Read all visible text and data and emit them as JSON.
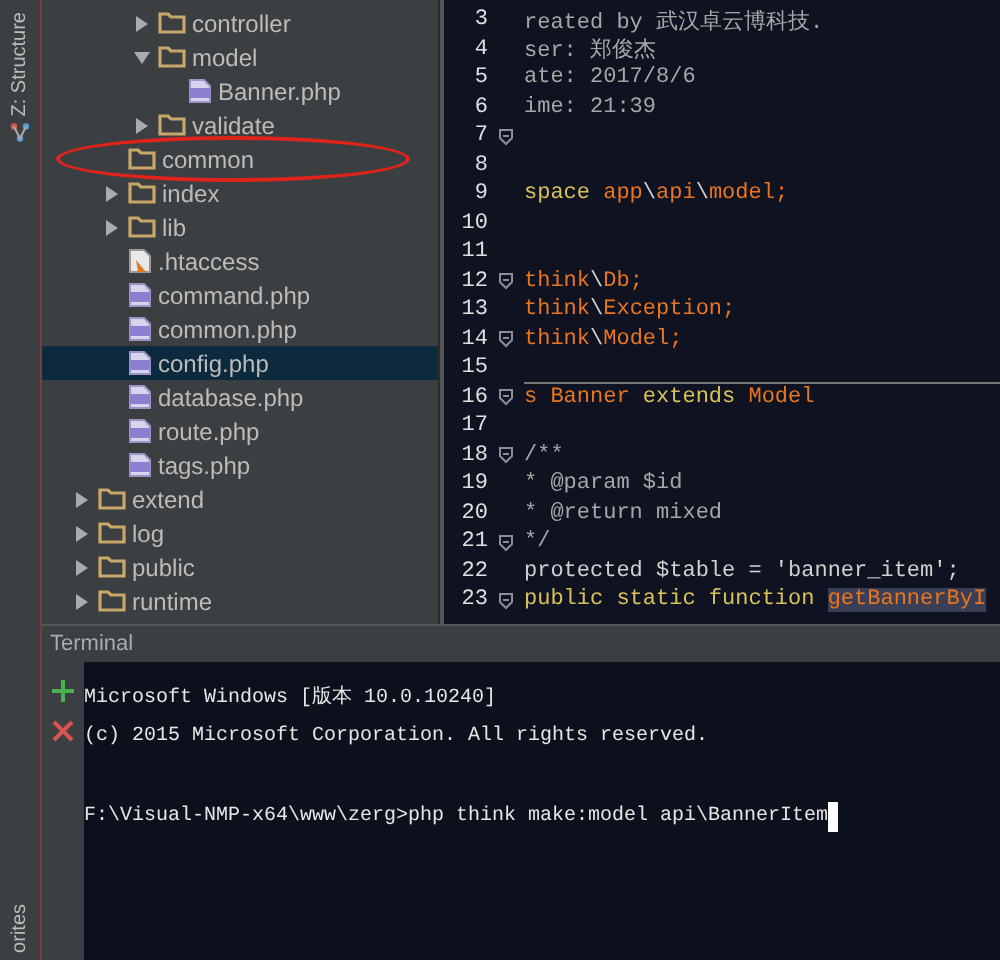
{
  "side_strip": {
    "top_tab": "Z: Structure",
    "bottom_tab": "orites"
  },
  "tree": [
    {
      "children": [
        {
          "children": [
            {
              "name": "controller",
              "kind": "folder",
              "expanded": false,
              "selected": false
            },
            {
              "name": "model",
              "kind": "folder",
              "expanded": true,
              "selected": false,
              "children": [
                {
                  "name": "Banner.php",
                  "kind": "php",
                  "selected": false
                }
              ]
            },
            {
              "name": "validate",
              "kind": "folder",
              "expanded": false,
              "selected": false
            }
          ]
        },
        {
          "name": "common",
          "kind": "folder",
          "selected": false,
          "circled": true
        },
        {
          "name": "index",
          "kind": "folder",
          "expanded": false,
          "selected": false
        },
        {
          "name": "lib",
          "kind": "folder",
          "expanded": false,
          "selected": false
        },
        {
          "name": ".htaccess",
          "kind": "htaccess",
          "selected": false
        },
        {
          "name": "command.php",
          "kind": "php",
          "selected": false
        },
        {
          "name": "common.php",
          "kind": "php",
          "selected": false
        },
        {
          "name": "config.php",
          "kind": "php",
          "selected": true
        },
        {
          "name": "database.php",
          "kind": "php",
          "selected": false
        },
        {
          "name": "route.php",
          "kind": "php",
          "selected": false
        },
        {
          "name": "tags.php",
          "kind": "php",
          "selected": false
        }
      ]
    },
    {
      "name": "extend",
      "kind": "folder",
      "expanded": false,
      "selected": false
    },
    {
      "name": "log",
      "kind": "folder",
      "expanded": false,
      "selected": false
    },
    {
      "name": "public",
      "kind": "folder",
      "expanded": false,
      "selected": false
    },
    {
      "name": "runtime",
      "kind": "folder",
      "expanded": false,
      "selected": false
    }
  ],
  "editor": {
    "lines": [
      {
        "number": "3",
        "segments": [
          {
            "text": "reated by 武汉卓云博科技.",
            "kind": "comment"
          }
        ]
      },
      {
        "number": "4",
        "segments": [
          {
            "text": "ser: 郑俊杰",
            "kind": "comment"
          }
        ]
      },
      {
        "number": "5",
        "segments": [
          {
            "text": "ate: 2017/8/6",
            "kind": "comment"
          }
        ]
      },
      {
        "number": "6",
        "segments": [
          {
            "text": "ime: 21:39",
            "kind": "comment"
          }
        ]
      },
      {
        "number": "7",
        "fold": true
      },
      {
        "number": "8"
      },
      {
        "number": "9",
        "segments": [
          {
            "text": "space ",
            "kind": "keyword"
          },
          {
            "text": "app",
            "kind": "name"
          },
          {
            "text": "\\",
            "kind": "plain"
          },
          {
            "text": "api",
            "kind": "name"
          },
          {
            "text": "\\",
            "kind": "plain"
          },
          {
            "text": "model;",
            "kind": "name"
          }
        ]
      },
      {
        "number": "10"
      },
      {
        "number": "11"
      },
      {
        "number": "12",
        "fold": true,
        "segments": [
          {
            "text": "think",
            "kind": "name"
          },
          {
            "text": "\\",
            "kind": "plain"
          },
          {
            "text": "Db;",
            "kind": "name"
          }
        ]
      },
      {
        "number": "13",
        "segments": [
          {
            "text": "think",
            "kind": "name"
          },
          {
            "text": "\\",
            "kind": "plain"
          },
          {
            "text": "Exception;",
            "kind": "name"
          }
        ]
      },
      {
        "number": "14",
        "fold": true,
        "segments": [
          {
            "text": "think",
            "kind": "name"
          },
          {
            "text": "\\",
            "kind": "plain"
          },
          {
            "text": "Model;",
            "kind": "name"
          }
        ]
      },
      {
        "number": "15",
        "separator": true
      },
      {
        "number": "16",
        "fold": true,
        "segments": [
          {
            "text": "s ",
            "kind": "name"
          },
          {
            "text": "Banner ",
            "kind": "name"
          },
          {
            "text": "extends ",
            "kind": "keyword"
          },
          {
            "text": "Model",
            "kind": "name"
          }
        ]
      },
      {
        "number": "17"
      },
      {
        "number": "18",
        "fold": true,
        "segments": [
          {
            "text": "/**",
            "kind": "comment"
          }
        ]
      },
      {
        "number": "19",
        "segments": [
          {
            "text": "  * @param $id",
            "kind": "comment"
          }
        ]
      },
      {
        "number": "20",
        "segments": [
          {
            "text": "  * @return mixed",
            "kind": "comment"
          }
        ]
      },
      {
        "number": "21",
        "fold": true,
        "segments": [
          {
            "text": "  */",
            "kind": "comment"
          }
        ]
      },
      {
        "number": "22",
        "segments": [
          {
            "text": "   protected $table = 'banner_item';",
            "kind": "plain"
          }
        ]
      },
      {
        "number": "23",
        "fold": true,
        "segments": [
          {
            "text": "public static function ",
            "kind": "keyword"
          },
          {
            "text": "getBannerByI",
            "kind": "match"
          }
        ]
      }
    ]
  },
  "terminal": {
    "title": "Terminal",
    "lines": [
      {
        "text": "Microsoft Windows [版本 10.0.10240]"
      },
      {
        "text": "(c) 2015 Microsoft Corporation. All rights reserved."
      },
      {
        "text": "F:\\Visual-NMP-x64\\www\\zerg>php think make:model api\\BannerItem",
        "cursor": true
      }
    ]
  }
}
